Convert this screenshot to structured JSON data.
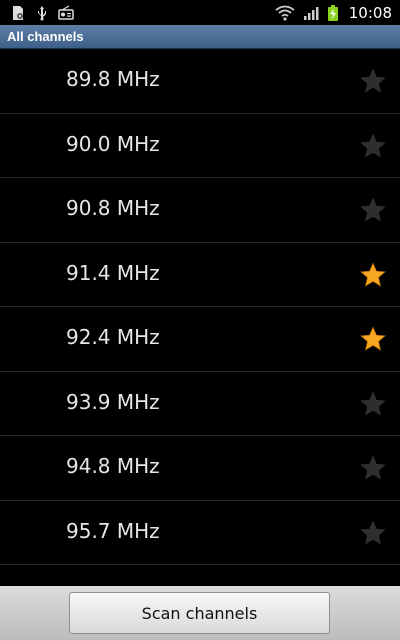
{
  "status_bar": {
    "time": "10:08",
    "icons": [
      "document-settings-icon",
      "usb-icon",
      "radio-icon",
      "wifi-icon",
      "signal-icon",
      "battery-charging-icon"
    ]
  },
  "header": {
    "title": "All channels"
  },
  "channels": [
    {
      "frequency": "89.8 MHz",
      "favorite": false
    },
    {
      "frequency": "90.0 MHz",
      "favorite": false
    },
    {
      "frequency": "90.8 MHz",
      "favorite": false
    },
    {
      "frequency": "91.4 MHz",
      "favorite": true
    },
    {
      "frequency": "92.4 MHz",
      "favorite": true
    },
    {
      "frequency": "93.9 MHz",
      "favorite": false
    },
    {
      "frequency": "94.8 MHz",
      "favorite": false
    },
    {
      "frequency": "95.7 MHz",
      "favorite": false
    }
  ],
  "footer": {
    "scan_label": "Scan channels"
  },
  "colors": {
    "header": "#4a6c95",
    "star_active": "#f5a623",
    "star_inactive": "#2e2e2e",
    "battery": "#8bd11f"
  }
}
